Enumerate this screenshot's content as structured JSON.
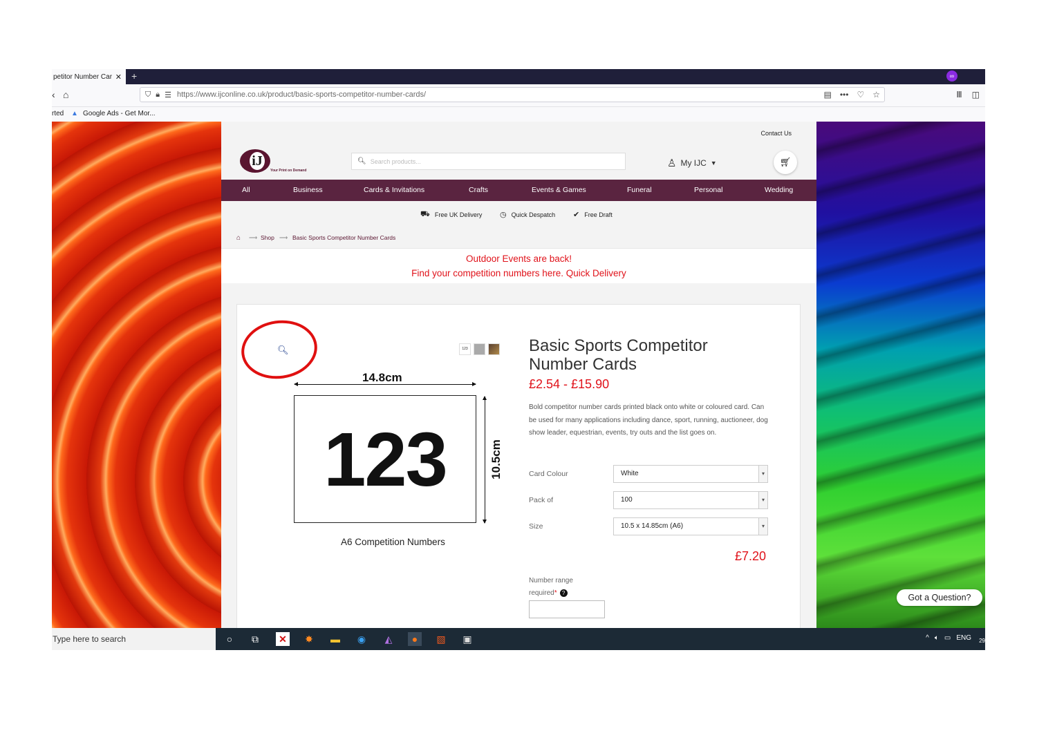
{
  "browser": {
    "tab_title": "petitor Number Car",
    "tab_close": "✕",
    "new_tab": "+",
    "extension_badge": "∞",
    "url": "https://www.ijconline.co.uk/product/basic-sports-competitor-number-cards/",
    "bookmarks": [
      "rted",
      "Google Ads - Get Mor..."
    ]
  },
  "site": {
    "contact": "Contact Us",
    "logo_tagline": "Your Print on Demand",
    "search_placeholder": "Search products...",
    "account": "My IJC",
    "categories": [
      "All",
      "Business",
      "Cards & Invitations",
      "Crafts",
      "Events & Games",
      "Funeral",
      "Personal",
      "Wedding"
    ],
    "features": [
      "Free UK Delivery",
      "Quick Despatch",
      "Free Draft"
    ],
    "breadcrumb": [
      "Shop",
      "Basic Sports Competitor Number Cards"
    ],
    "promo": [
      "Outdoor Events are back!",
      "Find your competition numbers here. Quick Delivery"
    ]
  },
  "product": {
    "image": {
      "width_label": "14.8cm",
      "height_label": "10.5cm",
      "number": "123",
      "caption": "A6 Competition Numbers",
      "thumb_label": "123"
    },
    "title": "Basic Sports Competitor Number Cards",
    "price_range": "£2.54 - £15.90",
    "description": "Bold competitor number cards printed black onto white or coloured card. Can be used for many applications including dance, sport, running, auctioneer, dog show leader, equestrian, events, try outs and the list goes on.",
    "options": [
      {
        "label": "Card Colour",
        "value": "White"
      },
      {
        "label": "Pack of",
        "value": "100"
      },
      {
        "label": "Size",
        "value": "10.5 x 14.85cm (A6)"
      }
    ],
    "price": "£7.20",
    "number_range_label": "Number range required",
    "required_mark": "*",
    "help_icon": "?"
  },
  "chat_widget": "Got a Question?",
  "taskbar": {
    "search": "Type here to search",
    "lang": "ENG",
    "clock_fragment": "29"
  },
  "colors": {
    "brand": "#5a2440",
    "accent_red": "#e0121a",
    "annotation_circle": "#e01010"
  }
}
